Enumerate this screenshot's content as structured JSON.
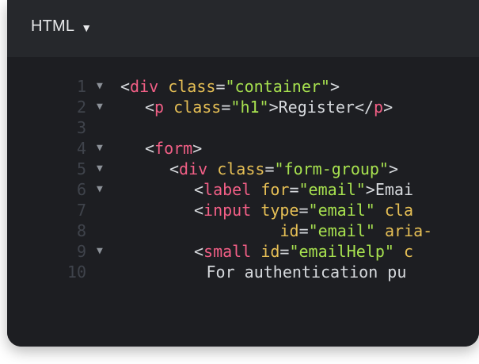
{
  "header": {
    "language": "HTML",
    "caret_icon": "triangle-down-icon"
  },
  "editor": {
    "lines": [
      {
        "num": "1",
        "fold": true,
        "indent": 0,
        "tokens": [
          [
            "punc",
            "<"
          ],
          [
            "tag",
            "div"
          ],
          [
            "punc",
            " "
          ],
          [
            "attr",
            "class"
          ],
          [
            "punc",
            "="
          ],
          [
            "str",
            "\"container\""
          ],
          [
            "punc",
            ">"
          ]
        ]
      },
      {
        "num": "2",
        "fold": true,
        "indent": 1,
        "tokens": [
          [
            "punc",
            "<"
          ],
          [
            "tag",
            "p"
          ],
          [
            "punc",
            " "
          ],
          [
            "attr",
            "class"
          ],
          [
            "punc",
            "="
          ],
          [
            "str",
            "\"h1\""
          ],
          [
            "punc",
            ">"
          ],
          [
            "text",
            "Register"
          ],
          [
            "punc",
            "</"
          ],
          [
            "tag",
            "p"
          ],
          [
            "punc",
            ">"
          ]
        ]
      },
      {
        "num": "3",
        "fold": false,
        "indent": 0,
        "tokens": []
      },
      {
        "num": "4",
        "fold": true,
        "indent": 1,
        "tokens": [
          [
            "punc",
            "<"
          ],
          [
            "tag",
            "form"
          ],
          [
            "punc",
            ">"
          ]
        ]
      },
      {
        "num": "5",
        "fold": true,
        "indent": 2,
        "tokens": [
          [
            "punc",
            "<"
          ],
          [
            "tag",
            "div"
          ],
          [
            "punc",
            " "
          ],
          [
            "attr",
            "class"
          ],
          [
            "punc",
            "="
          ],
          [
            "str",
            "\"form-group\""
          ],
          [
            "punc",
            ">"
          ]
        ]
      },
      {
        "num": "6",
        "fold": true,
        "indent": 3,
        "tokens": [
          [
            "punc",
            "<"
          ],
          [
            "tag",
            "label"
          ],
          [
            "punc",
            " "
          ],
          [
            "attr",
            "for"
          ],
          [
            "punc",
            "="
          ],
          [
            "str",
            "\"email\""
          ],
          [
            "punc",
            ">"
          ],
          [
            "text",
            "Emai"
          ]
        ]
      },
      {
        "num": "7",
        "fold": false,
        "indent": 3,
        "tokens": [
          [
            "punc",
            "<"
          ],
          [
            "tag",
            "input"
          ],
          [
            "punc",
            " "
          ],
          [
            "attr",
            "type"
          ],
          [
            "punc",
            "="
          ],
          [
            "str",
            "\"email\""
          ],
          [
            "punc",
            " "
          ],
          [
            "attr",
            "cla"
          ]
        ]
      },
      {
        "num": "8",
        "fold": false,
        "indent": 6.5,
        "tokens": [
          [
            "attr",
            "id"
          ],
          [
            "punc",
            "="
          ],
          [
            "str",
            "\"email\""
          ],
          [
            "punc",
            " "
          ],
          [
            "attr",
            "aria-"
          ]
        ]
      },
      {
        "num": "9",
        "fold": true,
        "indent": 3,
        "tokens": [
          [
            "punc",
            "<"
          ],
          [
            "tag",
            "small"
          ],
          [
            "punc",
            " "
          ],
          [
            "attr",
            "id"
          ],
          [
            "punc",
            "="
          ],
          [
            "str",
            "\"emailHelp\""
          ],
          [
            "punc",
            " "
          ],
          [
            "attr",
            "c"
          ]
        ]
      },
      {
        "num": "10",
        "fold": false,
        "indent": 3.5,
        "tokens": [
          [
            "text",
            "For authentication pu"
          ]
        ]
      }
    ]
  }
}
